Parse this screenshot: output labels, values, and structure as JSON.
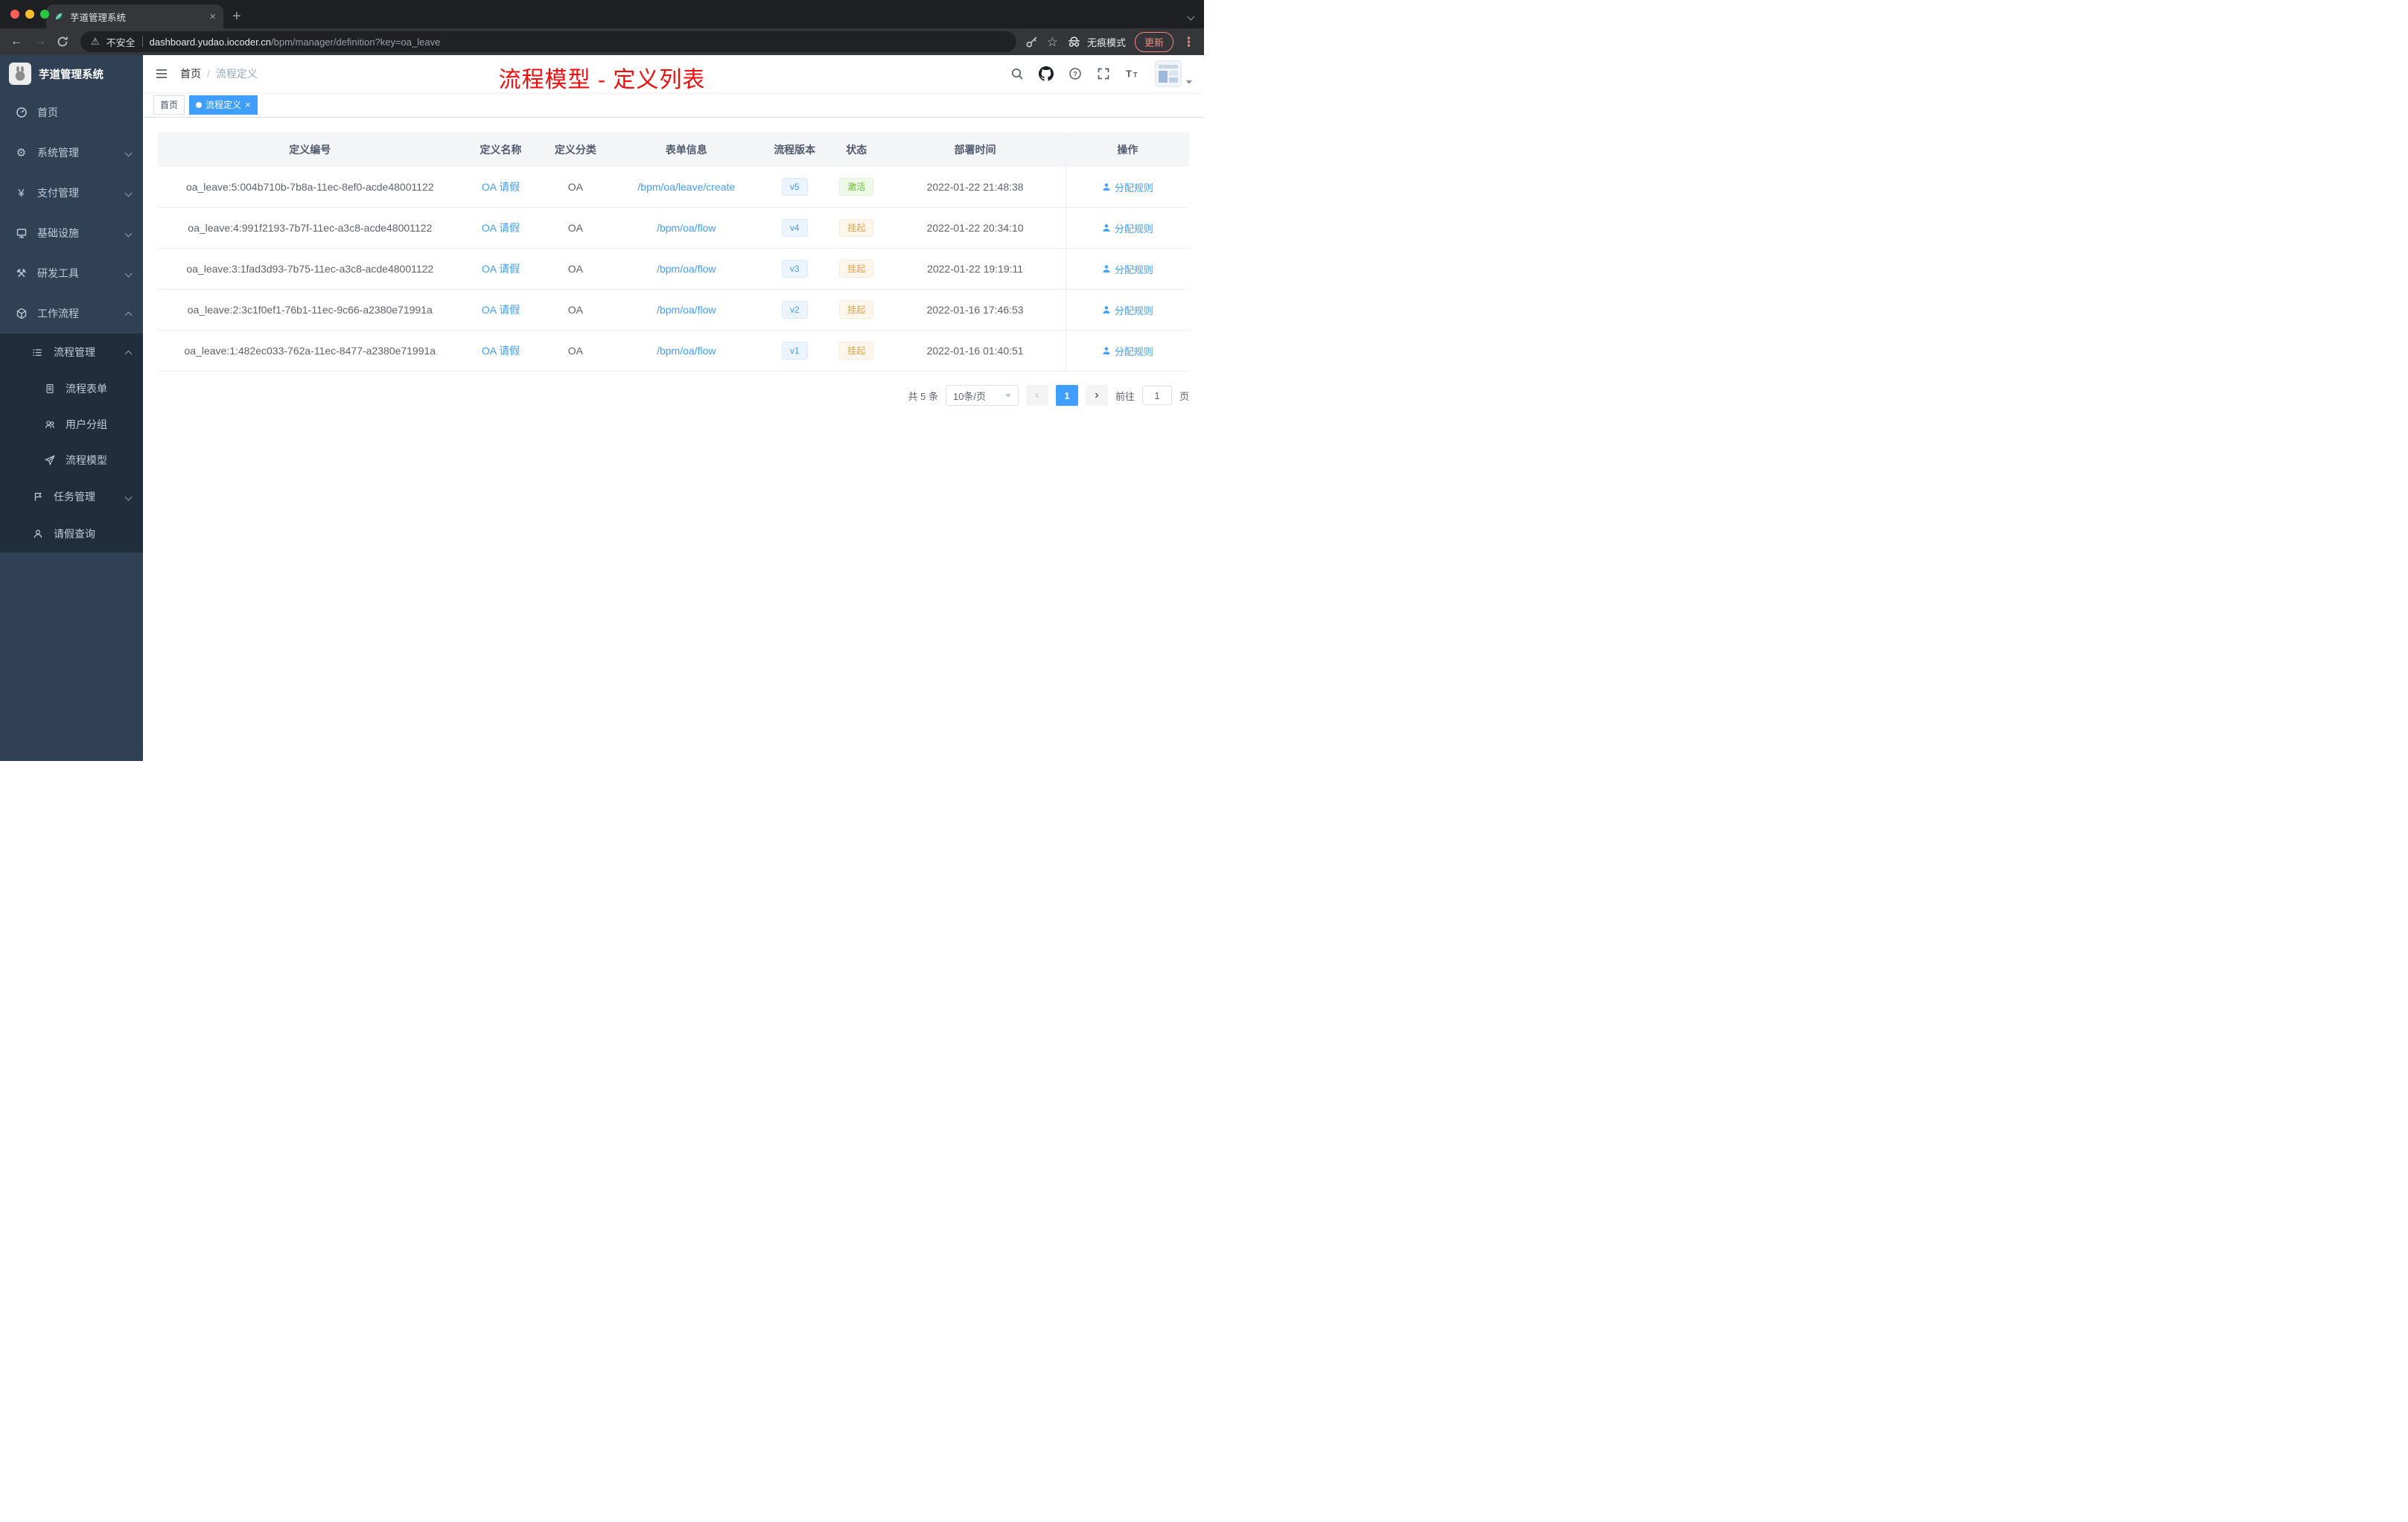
{
  "browser": {
    "tab_title": "芋道管理系统",
    "security_label": "不安全",
    "url_host": "dashboard.yudao.iocoder.cn",
    "url_path": "/bpm/manager/definition?key=oa_leave",
    "incognito_label": "无痕模式",
    "update_label": "更新"
  },
  "icons": {
    "warning": "⚠",
    "star": "☆",
    "gear": "⚙",
    "tools": "⚒",
    "yen": "¥",
    "close": "×",
    "plus": "+",
    "menu_dots": "⋮",
    "back_arrow": "←",
    "forward_arrow": "→",
    "prev": "‹",
    "next": "›"
  },
  "sidebar": {
    "logo_title": "芋道管理系统",
    "items_top": [
      "首页",
      "系统管理",
      "支付管理",
      "基础设施",
      "研发工具",
      "工作流程"
    ],
    "items_sub": [
      "流程管理",
      "流程表单",
      "用户分组",
      "流程模型",
      "任务管理",
      "请假查询"
    ]
  },
  "header": {
    "breadcrumb_home": "首页",
    "breadcrumb_separator": "/",
    "breadcrumb_current": "流程定义",
    "overlay_title": "流程模型 - 定义列表"
  },
  "tags": {
    "home": "首页",
    "active": "流程定义"
  },
  "table": {
    "columns": [
      "定义编号",
      "定义名称",
      "定义分类",
      "表单信息",
      "流程版本",
      "状态",
      "部署时间",
      "操作"
    ],
    "rows": [
      {
        "id": "oa_leave:5:004b710b-7b8a-11ec-8ef0-acde48001122",
        "name": "OA 请假",
        "category": "OA",
        "form": "/bpm/oa/leave/create",
        "version": "v5",
        "status": "激活",
        "status_type": "active",
        "time": "2022-01-22 21:48:38",
        "action": "分配规则"
      },
      {
        "id": "oa_leave:4:991f2193-7b7f-11ec-a3c8-acde48001122",
        "name": "OA 请假",
        "category": "OA",
        "form": "/bpm/oa/flow",
        "version": "v4",
        "status": "挂起",
        "status_type": "suspended",
        "time": "2022-01-22 20:34:10",
        "action": "分配规则"
      },
      {
        "id": "oa_leave:3:1fad3d93-7b75-11ec-a3c8-acde48001122",
        "name": "OA 请假",
        "category": "OA",
        "form": "/bpm/oa/flow",
        "version": "v3",
        "status": "挂起",
        "status_type": "suspended",
        "time": "2022-01-22 19:19:11",
        "action": "分配规则"
      },
      {
        "id": "oa_leave:2:3c1f0ef1-76b1-11ec-9c66-a2380e71991a",
        "name": "OA 请假",
        "category": "OA",
        "form": "/bpm/oa/flow",
        "version": "v2",
        "status": "挂起",
        "status_type": "suspended",
        "time": "2022-01-16 17:46:53",
        "action": "分配规则"
      },
      {
        "id": "oa_leave:1:482ec033-762a-11ec-8477-a2380e71991a",
        "name": "OA 请假",
        "category": "OA",
        "form": "/bpm/oa/flow",
        "version": "v1",
        "status": "挂起",
        "status_type": "suspended",
        "time": "2022-01-16 01:40:51",
        "action": "分配规则"
      }
    ]
  },
  "pagination": {
    "total": "共 5 条",
    "page_size": "10条/页",
    "page": "1",
    "goto_label": "前往",
    "goto_value": "1",
    "goto_unit": "页"
  },
  "colors": {
    "accent": "#409eff",
    "title_red": "#f20d0d",
    "status_active_green": "#67c23a",
    "status_suspended_orange": "#e6a23c",
    "traffic_red": "#ff5f57",
    "traffic_yellow": "#febc2e",
    "traffic_green": "#28c840"
  }
}
